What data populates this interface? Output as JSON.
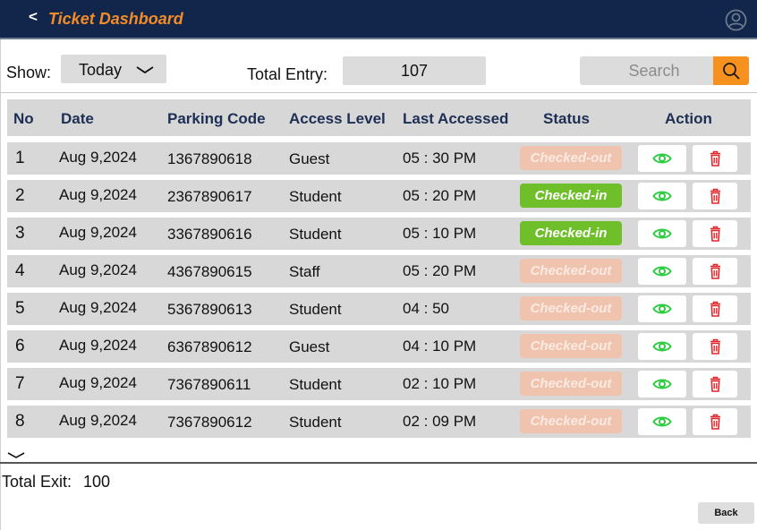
{
  "header": {
    "back_glyph": "<",
    "title": "Ticket Dashboard",
    "title_color": "#f28c28",
    "background": "#12254a",
    "avatar_icon": "user-circle-icon"
  },
  "toolbar": {
    "show_label": "Show:",
    "show_value": "Today",
    "total_label": "Total Entry:",
    "total_value": "107",
    "search_placeholder": "Search",
    "search_icon": "search-icon",
    "accent": "#f6901e"
  },
  "table": {
    "columns": [
      "No",
      "Date",
      "Parking Code",
      "Access Level",
      "Last Accessed",
      "Status",
      "Action"
    ],
    "rows": [
      {
        "no": "1",
        "date": "Aug 9,2024",
        "code": "1367890618",
        "level": "Guest",
        "time": "05 : 30 PM",
        "status": "Checked-out",
        "state": "out"
      },
      {
        "no": "2",
        "date": "Aug 9,2024",
        "code": "2367890617",
        "level": "Student",
        "time": "05 : 20 PM",
        "status": "Checked-in",
        "state": "in"
      },
      {
        "no": "3",
        "date": "Aug 9,2024",
        "code": "3367890616",
        "level": "Student",
        "time": "05 : 10 PM",
        "status": "Checked-in",
        "state": "in"
      },
      {
        "no": "4",
        "date": "Aug 9,2024",
        "code": "4367890615",
        "level": "Staff",
        "time": "05 : 20 PM",
        "status": "Checked-out",
        "state": "out"
      },
      {
        "no": "5",
        "date": "Aug 9,2024",
        "code": "5367890613",
        "level": "Student",
        "time": "04 : 50",
        "status": "Checked-out",
        "state": "out"
      },
      {
        "no": "6",
        "date": "Aug 9,2024",
        "code": "6367890612",
        "level": "Guest",
        "time": "04 : 10 PM",
        "status": "Checked-out",
        "state": "out"
      },
      {
        "no": "7",
        "date": "Aug 9,2024",
        "code": "7367890611",
        "level": "Student",
        "time": "02 : 10 PM",
        "status": "Checked-out",
        "state": "out"
      },
      {
        "no": "8",
        "date": "Aug 9,2024",
        "code": "7367890612",
        "level": "Student",
        "time": "02 : 09 PM",
        "status": "Checked-out",
        "state": "out"
      }
    ],
    "status_colors": {
      "in": "#6fbf2a",
      "out": "#efc3ad"
    },
    "action_icons": {
      "view": "eye-icon",
      "delete": "trash-icon"
    },
    "view_color": "#2ecc40",
    "delete_color": "#e0262b"
  },
  "footer": {
    "exit_label": "Total Exit:",
    "exit_value": "100",
    "back_label": "Back"
  }
}
